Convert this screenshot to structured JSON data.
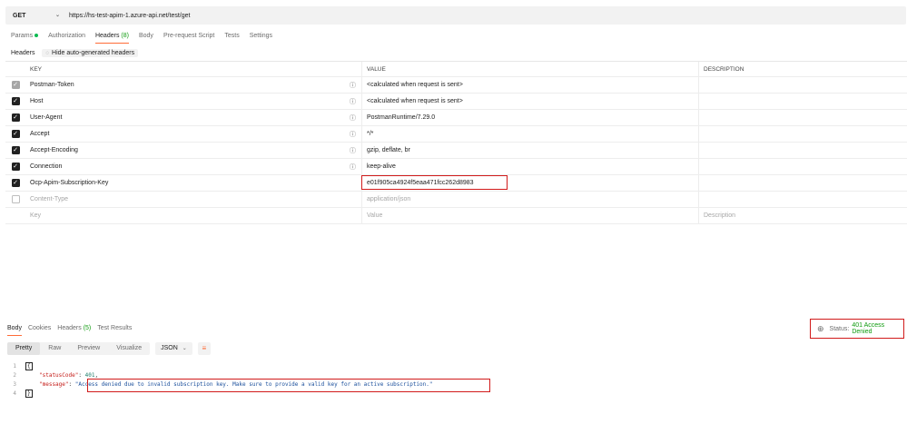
{
  "request": {
    "method": "GET",
    "url": "https://hs-test-apim-1.azure-api.net/test/get"
  },
  "request_tabs": [
    {
      "label": "Params",
      "count": ""
    },
    {
      "label": "Authorization",
      "count": ""
    },
    {
      "label": "Headers",
      "count": "(8)"
    },
    {
      "label": "Body",
      "count": ""
    },
    {
      "label": "Pre-request Script",
      "count": ""
    },
    {
      "label": "Tests",
      "count": ""
    },
    {
      "label": "Settings",
      "count": ""
    }
  ],
  "headers_section": {
    "title": "Headers",
    "hide_button": "Hide auto-generated headers"
  },
  "table": {
    "columns": {
      "key": "KEY",
      "value": "VALUE",
      "description": "DESCRIPTION"
    },
    "rows": [
      {
        "key": "Postman-Token",
        "value": "<calculated when request is sent>",
        "checked": true,
        "auto": true
      },
      {
        "key": "Host",
        "value": "<calculated when request is sent>",
        "checked": true,
        "auto": true
      },
      {
        "key": "User-Agent",
        "value": "PostmanRuntime/7.29.0",
        "checked": true,
        "auto": true
      },
      {
        "key": "Accept",
        "value": "*/*",
        "checked": true,
        "auto": true
      },
      {
        "key": "Accept-Encoding",
        "value": "gzip, deflate, br",
        "checked": true,
        "auto": true
      },
      {
        "key": "Connection",
        "value": "keep-alive",
        "checked": true,
        "auto": true
      },
      {
        "key": "Ocp-Apim-Subscription-Key",
        "value": "e01f905ca4924f5eaa471fcc262d8983",
        "checked": true,
        "auto": false
      },
      {
        "key": "Content-Type",
        "value": "application/json",
        "checked": false,
        "auto": false
      }
    ],
    "new_row": {
      "key_placeholder": "Key",
      "value_placeholder": "Value",
      "description_placeholder": "Description"
    }
  },
  "response_tabs": [
    {
      "label": "Body",
      "count": ""
    },
    {
      "label": "Cookies",
      "count": ""
    },
    {
      "label": "Headers",
      "count": "(5)"
    },
    {
      "label": "Test Results",
      "count": ""
    }
  ],
  "status": {
    "label": "Status:",
    "value": "401 Access Denied"
  },
  "view_modes": [
    "Pretty",
    "Raw",
    "Preview",
    "Visualize"
  ],
  "format": "JSON",
  "response_body": {
    "line_numbers": [
      "1",
      "2",
      "3",
      "4"
    ],
    "open_brace": "{",
    "close_brace": "}",
    "status_key": "\"statusCode\"",
    "status_value": "401",
    "message_key": "\"message\"",
    "message_value": "\"Access denied due to invalid subscription key. Make sure to provide a valid key for an active subscription.\""
  },
  "icons": {
    "info": "info-icon",
    "eye": "eye-off-icon",
    "globe": "globe-icon",
    "wrap": "wrap-lines-icon",
    "chevron": "chevron-down-icon"
  },
  "colors": {
    "accent": "#ff6c37",
    "success": "#0f9b0f",
    "highlight_box": "#d11a1a"
  }
}
